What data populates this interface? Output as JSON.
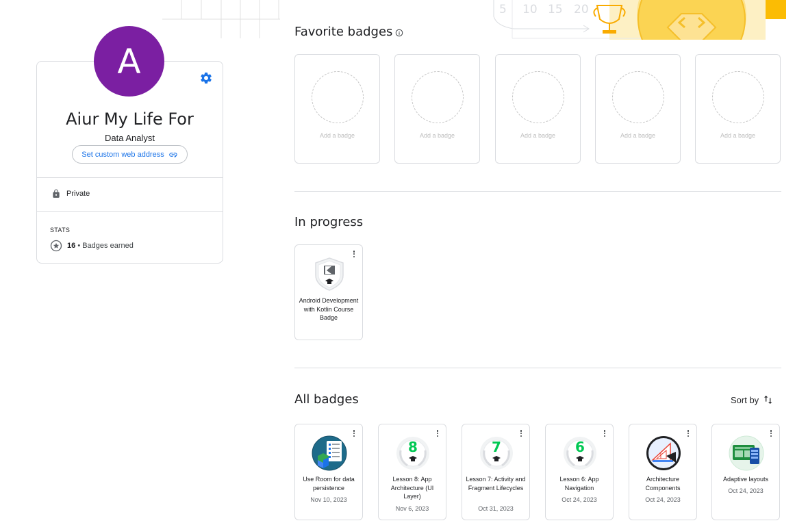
{
  "header_art": {
    "numbers": [
      "5",
      "10",
      "15",
      "20"
    ]
  },
  "profile": {
    "avatar_letter": "A",
    "name": "Aiur My Life For",
    "title": "Data Analyst",
    "custom_url_label": "Set custom web address",
    "privacy": "Private",
    "stats_label": "STATS",
    "badges_earned_count": "16",
    "badges_earned_suffix": "• Badges earned",
    "avatar_color": "#7b1fa2",
    "accent_color": "#1a73e8"
  },
  "favorites": {
    "title": "Favorite badges",
    "slots": [
      {
        "label": "Add a badge"
      },
      {
        "label": "Add a badge"
      },
      {
        "label": "Add a badge"
      },
      {
        "label": "Add a badge"
      },
      {
        "label": "Add a badge"
      }
    ]
  },
  "in_progress": {
    "title": "In progress",
    "items": [
      {
        "name": "Android Development with Kotlin Course Badge",
        "icon": "kotlin-course-badge-icon"
      }
    ]
  },
  "all_badges": {
    "title": "All badges",
    "sort_label": "Sort by",
    "items": [
      {
        "name": "Use Room for data persistence",
        "date": "Nov 10, 2023",
        "icon": "room-database-icon"
      },
      {
        "name": "Lesson 8: App Architecture (UI Layer)",
        "date": "Nov 6, 2023",
        "icon": "lesson-badge-icon",
        "number": "8"
      },
      {
        "name": "Lesson 7: Activity and Fragment Lifecycles",
        "date": "Oct 31, 2023",
        "icon": "lesson-badge-icon",
        "number": "7"
      },
      {
        "name": "Lesson 6: App Navigation",
        "date": "Oct 24, 2023",
        "icon": "lesson-badge-icon",
        "number": "6"
      },
      {
        "name": "Architecture Components",
        "date": "Oct 24, 2023",
        "icon": "architecture-icon"
      },
      {
        "name": "Adaptive layouts",
        "date": "Oct 24, 2023",
        "icon": "adaptive-layouts-icon"
      }
    ]
  }
}
